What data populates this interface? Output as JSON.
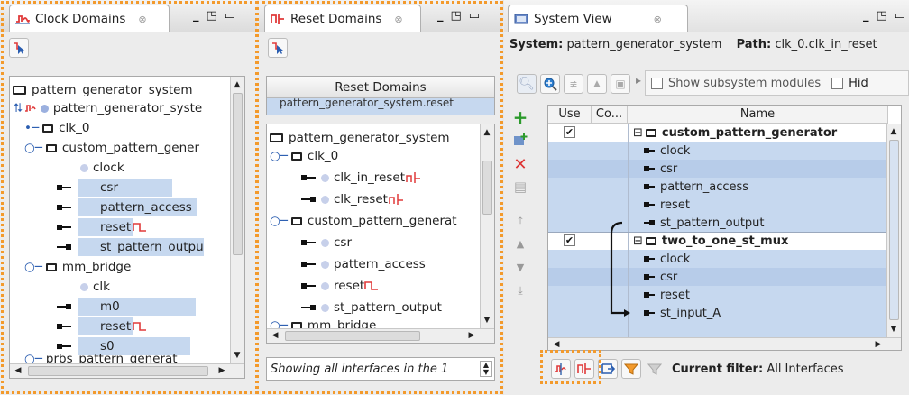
{
  "clock_pane": {
    "tab_title": "Clock Domains",
    "close_glyph": "⊗",
    "tree": [
      {
        "text": "pattern_generator_system"
      },
      {
        "text": "pattern_generator_syste"
      },
      {
        "text": "clk_0"
      },
      {
        "text": "custom_pattern_gener"
      },
      {
        "text": "clock"
      },
      {
        "text": "csr"
      },
      {
        "text": "pattern_access"
      },
      {
        "text": "reset"
      },
      {
        "text": "st_pattern_outpu"
      },
      {
        "text": "mm_bridge"
      },
      {
        "text": "clk"
      },
      {
        "text": "m0"
      },
      {
        "text": "reset"
      },
      {
        "text": "s0"
      },
      {
        "text": "prbs_pattern_generat"
      }
    ]
  },
  "reset_pane": {
    "tab_title": "Reset Domains",
    "close_glyph": "⊗",
    "header_button": "Reset Domains",
    "selected_item": "pattern_generator_system.reset",
    "tree": [
      {
        "text": "pattern_generator_system"
      },
      {
        "text": "clk_0"
      },
      {
        "text": "clk_in_reset"
      },
      {
        "text": "clk_reset"
      },
      {
        "text": "custom_pattern_generat"
      },
      {
        "text": "csr"
      },
      {
        "text": "pattern_access"
      },
      {
        "text": "reset"
      },
      {
        "text": "st_pattern_output"
      },
      {
        "text": "mm_bridge"
      }
    ],
    "status_text": "Showing all interfaces in the 1"
  },
  "system_pane": {
    "tab_title": "System View",
    "close_glyph": "⊗",
    "system_label": "System:",
    "system_value": "pattern_generator_system",
    "path_label": "Path:",
    "path_value": "clk_0.clk_in_reset",
    "show_subsystem_label": "Show subsystem modules",
    "hide_label": "Hid",
    "columns": [
      "Use",
      "Co...",
      "Name"
    ],
    "rows": [
      {
        "text": "custom_pattern_generator",
        "kind": "module",
        "use": "✔"
      },
      {
        "text": "clock",
        "kind": "in"
      },
      {
        "text": "csr",
        "kind": "in"
      },
      {
        "text": "pattern_access",
        "kind": "in"
      },
      {
        "text": "reset",
        "kind": "in"
      },
      {
        "text": "st_pattern_output",
        "kind": "out"
      },
      {
        "text": "two_to_one_st_mux",
        "kind": "module",
        "use": "✔"
      },
      {
        "text": "clock",
        "kind": "in"
      },
      {
        "text": "csr",
        "kind": "in"
      },
      {
        "text": "reset",
        "kind": "in"
      },
      {
        "text": "st_input_A",
        "kind": "in"
      }
    ],
    "filter_label": "Current filter:",
    "filter_value": "All Interfaces"
  },
  "colors": {
    "highlight": "#c6d8ef",
    "dashed_border": "#f39a2c",
    "reset_icon": "#e03a3a",
    "clock_icon": "#e03a3a"
  }
}
